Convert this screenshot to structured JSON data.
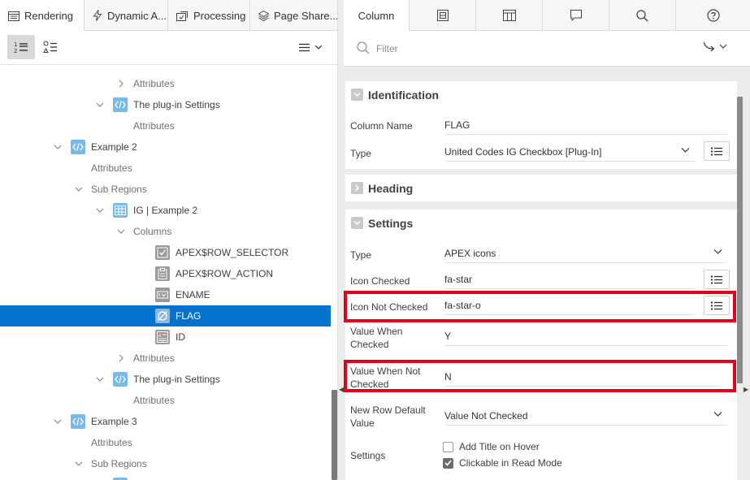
{
  "left_tabs": [
    {
      "label": "Rendering",
      "icon": "rendering-icon"
    },
    {
      "label": "Dynamic A...",
      "icon": "lightning-icon"
    },
    {
      "label": "Processing",
      "icon": "processing-icon"
    },
    {
      "label": "Page Share...",
      "icon": "page-shared-icon"
    }
  ],
  "tree": [
    {
      "label": "Attributes",
      "chevron": "right",
      "icon": null
    },
    {
      "label": "The plug-in Settings",
      "chevron": "down",
      "icon": "code-icon"
    },
    {
      "label": "Attributes",
      "chevron": null,
      "icon": null
    },
    {
      "label": "Example 2",
      "chevron": "down",
      "icon": "code-icon"
    },
    {
      "label": "Attributes",
      "chevron": null,
      "icon": null
    },
    {
      "label": "Sub Regions",
      "chevron": "down",
      "icon": null
    },
    {
      "label": "IG | Example 2",
      "chevron": "down",
      "icon": "grid-icon"
    },
    {
      "label": "Columns",
      "chevron": "down",
      "icon": null
    },
    {
      "label": "APEX$ROW_SELECTOR",
      "chevron": null,
      "icon": "checkbox-column-icon"
    },
    {
      "label": "APEX$ROW_ACTION",
      "chevron": null,
      "icon": "clipboard-column-icon"
    },
    {
      "label": "ENAME",
      "chevron": null,
      "icon": "text-column-icon"
    },
    {
      "label": "FLAG",
      "chevron": null,
      "icon": "plugin-column-icon",
      "selected": true
    },
    {
      "label": "ID",
      "chevron": null,
      "icon": "number-column-icon"
    },
    {
      "label": "Attributes",
      "chevron": "right",
      "icon": null
    },
    {
      "label": "The plug-in Settings",
      "chevron": "down",
      "icon": "code-icon"
    },
    {
      "label": "Attributes",
      "chevron": null,
      "icon": null
    },
    {
      "label": "Example 3",
      "chevron": "down",
      "icon": "code-icon"
    },
    {
      "label": "Attributes",
      "chevron": null,
      "icon": null
    },
    {
      "label": "Sub Regions",
      "chevron": "down",
      "icon": null
    }
  ],
  "right_tabs": {
    "column": "Column",
    "icons": [
      "grouping-icon",
      "layout-icon",
      "comments-icon",
      "search-icon",
      "help-icon"
    ]
  },
  "filter": {
    "placeholder": "Filter"
  },
  "sections": {
    "identification": "Identification",
    "heading": "Heading",
    "settings": "Settings"
  },
  "identification": {
    "column_name_label": "Column Name",
    "column_name_value": "FLAG",
    "type_label": "Type",
    "type_value": "United Codes IG Checkbox [Plug-In]"
  },
  "settings": {
    "type_label": "Type",
    "type_value": "APEX icons",
    "icon_checked_label": "Icon Checked",
    "icon_checked_value": "fa-star",
    "icon_not_checked_label": "Icon Not Checked",
    "icon_not_checked_value": "fa-star-o",
    "value_when_checked_label": "Value When Checked",
    "value_when_checked_value": "Y",
    "value_when_not_checked_label": "Value When Not Checked",
    "value_when_not_checked_value": "N",
    "new_row_default_label": "New Row Default Value",
    "new_row_default_value": "Value Not Checked",
    "settings_label": "Settings",
    "checkbox_add_title": "Add Title on Hover",
    "checkbox_add_title_checked": false,
    "checkbox_clickable": "Clickable in Read Mode",
    "checkbox_clickable_checked": true
  },
  "colors": {
    "selection": "#0572ce",
    "highlight_box": "#e2001a",
    "code_icon": "#77b9e8"
  }
}
